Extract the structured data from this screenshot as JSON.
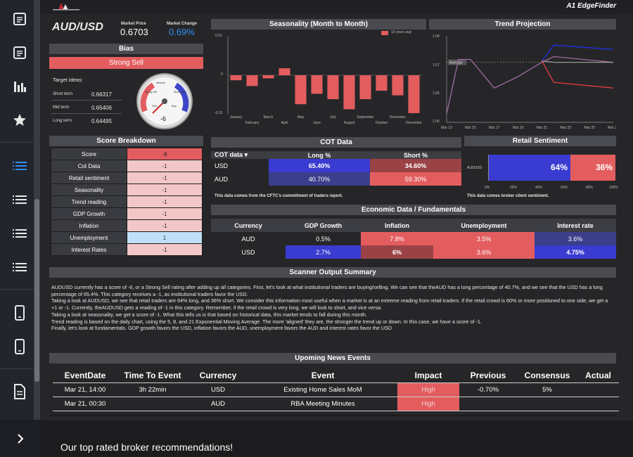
{
  "sidebar": {
    "icons": [
      "document-icon",
      "document-icon",
      "chart-bars-icon",
      "star-icon",
      "list-icon",
      "list-icon",
      "list-icon",
      "list-icon",
      "mobile-icon",
      "mobile-icon",
      "page-icon"
    ],
    "expand_icon": "chevron-right-icon"
  },
  "header": {
    "brand": "A1 EdgeFinder"
  },
  "pair": {
    "symbol": "AUD/USD",
    "price_label": "Market Price",
    "price": "0.6703",
    "change_label": "Market Change",
    "change": "0.69%"
  },
  "bias": {
    "title": "Bias",
    "value": "Strong Sell",
    "targets_title": "Target ideas:",
    "targets": [
      {
        "label": "Short term",
        "value": "0.66317"
      },
      {
        "label": "Mid term",
        "value": "0.65406"
      },
      {
        "label": "Long term",
        "value": "0.64495"
      }
    ],
    "gauge": {
      "value": "-6",
      "neutral": "Neutral",
      "sell": "Sell",
      "buy": "Buy",
      "s_sell": "Strong Sell",
      "s_buy": "Strong Buy"
    }
  },
  "seasonality": {
    "title": "Seasonality (Month to Month)",
    "legend": "10 years avg",
    "y_ticks": [
      "0.01",
      "0",
      "-0.01"
    ]
  },
  "trend": {
    "title": "Trend Projection",
    "y_ticks": [
      "1.08",
      "1.07",
      "1.06",
      "1.05"
    ],
    "x_ticks": [
      "Mar 13",
      "Mar 15",
      "Mar 17",
      "Mar 19",
      "Mar 21",
      "Mar 23",
      "Mar 25",
      "Mar 27"
    ],
    "avg_label": "Average"
  },
  "score": {
    "title": "Score Breakdown",
    "rows": [
      {
        "label": "Score",
        "value": "-6"
      },
      {
        "label": "Cot Data",
        "value": "-1"
      },
      {
        "label": "Retail sentiment",
        "value": "-1"
      },
      {
        "label": "Seasonality",
        "value": "-1"
      },
      {
        "label": "Trend reading",
        "value": "-1"
      },
      {
        "label": "GDP Growth",
        "value": "-1"
      },
      {
        "label": "Inflation",
        "value": "-1"
      },
      {
        "label": "Unemployment",
        "value": "1"
      },
      {
        "label": "Interest Rates",
        "value": "-1"
      }
    ]
  },
  "cot": {
    "title": "COT Data",
    "headers": [
      "COT data",
      "Long %",
      "Short %"
    ],
    "rows": [
      {
        "label": "USD",
        "long": "65.40%",
        "short": "34.60%"
      },
      {
        "label": "AUD",
        "long": "40.70%",
        "short": "59.30%"
      }
    ],
    "note": "This data comes from the CFTC's commitment of traders report."
  },
  "retail": {
    "title": "Retail Sentiment",
    "pair": "AUDUSD",
    "long": "64%",
    "short": "36%",
    "ticks": [
      "0%",
      "20%",
      "40%",
      "60%",
      "80%",
      "100%"
    ],
    "note": "This data comes broker client sentiment."
  },
  "econ": {
    "title": "Economic Data / Fundamentals",
    "headers": [
      "Currency",
      "GDP Growth",
      "Inflation",
      "Unemployment",
      "Interest rate"
    ],
    "rows": [
      [
        "AUD",
        "0.5%",
        "7.8%",
        "3.5%",
        "3.6%"
      ],
      [
        "USD",
        "2.7%",
        "6%",
        "3.6%",
        "4.75%"
      ]
    ]
  },
  "scanner": {
    "title": "Scanner Output Summary",
    "text": "AUDUSD currently has a score of -6, or a Strong Sell rating after adding up all categories. First, let's look at what institutional traders are buying/selling. We can see that theAUD has a long percentage of 40.7%, and we see that the USD has a long percentage of 65.4%. This category receives a -1, as institutional traders favor the USD.\nTaking a look at AUDUSD, we see that retail traders are 64% long, and 36% short. We consider this information most useful when a market is at an extreme reading from retail traders. If the retail crowd is 60% or more positioned to one side, we get a +1 or -1. Currently, theAUDUSD gets a reading of -1 in this category. Remember, if the retail crowd is very long, we will look to short, and vice versa.\nTaking a look at seasonality, we get a score of -1. What this tells us is that based on historical data, this market tends to fall during this month.\nTrend reading is based on the daily chart, using the 5, 8, and 21 Exponential Moving Average. The more 'aligned' they are, the stronger the trend up or down. In this case, we have a score of -1.\nFinally, let's look at fundamentals. GDP growth favors the USD, inflation favors the AUD, unemployment favors the AUD and interest rates favor the USD"
  },
  "news": {
    "title": "Upoming News Events",
    "headers": [
      "EventDate",
      "Time To Event",
      "Currency",
      "Event",
      "Impact",
      "Previous",
      "Consensus",
      "Actual"
    ],
    "rows": [
      [
        "Mar 21, 14:00",
        "3h 22min",
        "USD",
        "Existing Home Sales MoM",
        "High",
        "-0.70%",
        "5%",
        ""
      ],
      [
        "Mar 21, 00:30",
        "",
        "AUD",
        "RBA Meeting Minutes",
        "High",
        "",
        "",
        ""
      ]
    ]
  },
  "brokers": {
    "title": "Our top rated broker recommendations!"
  },
  "chart_data": [
    {
      "type": "bar",
      "title": "Seasonality (Month to Month)",
      "categories": [
        "January",
        "February",
        "March",
        "April",
        "May",
        "June",
        "July",
        "August",
        "September",
        "October",
        "November",
        "December"
      ],
      "series": [
        {
          "name": "10 years avg",
          "values": [
            -0.0013,
            -0.0028,
            -0.0008,
            0.0018,
            -0.0075,
            -0.0048,
            -0.0062,
            -0.0088,
            -0.0062,
            -0.004,
            -0.0052,
            -0.0098
          ]
        }
      ],
      "ylim": [
        -0.01,
        0.01
      ],
      "color": "#e35d5f"
    },
    {
      "type": "line",
      "title": "Trend Projection",
      "x": [
        "Mar 13",
        "Mar 14",
        "Mar 15",
        "Mar 17",
        "Mar 19",
        "Mar 21",
        "Mar 22",
        "Mar 27"
      ],
      "series": [
        {
          "values": [
            1.053,
            1.072,
            1.072,
            1.062,
            1.066,
            1.071,
            1.073,
            1.071
          ],
          "color": "#a06ba0"
        },
        {
          "values": [
            null,
            null,
            null,
            null,
            null,
            1.0715,
            1.077,
            1.0755
          ],
          "color": "#1d2fe0"
        },
        {
          "values": [
            null,
            null,
            null,
            null,
            null,
            1.0715,
            1.064,
            1.062
          ],
          "color": "#e53a3a"
        },
        {
          "values": [
            null,
            null,
            null,
            null,
            null,
            1.0715,
            1.071,
            1.071
          ],
          "color": "#999999"
        }
      ],
      "ylim": [
        1.05,
        1.08
      ]
    }
  ]
}
